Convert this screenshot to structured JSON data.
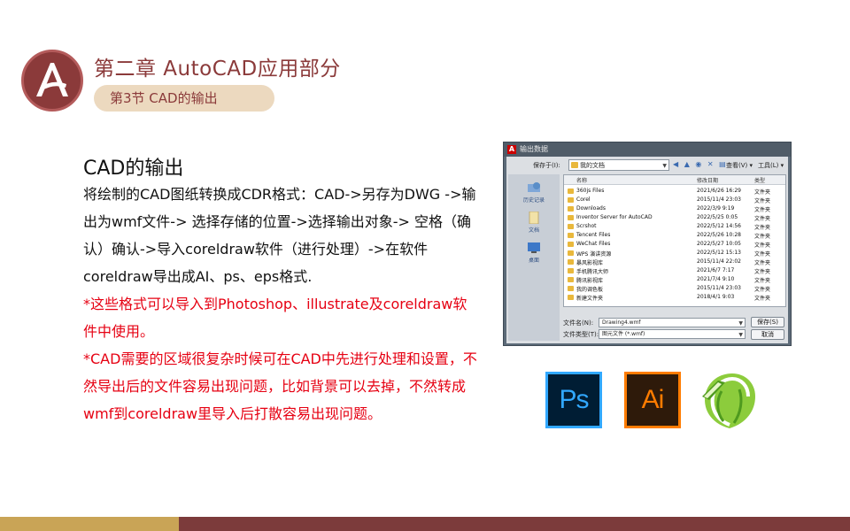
{
  "header": {
    "chapter_title": "第二章   AutoCAD应用部分",
    "section_label": "第3节  CAD的输出",
    "logo_letter": "A",
    "colors": {
      "brand": "#8b3a3a",
      "pill": "#ecd9bf"
    }
  },
  "content": {
    "heading": "CAD的输出",
    "paragraphs": [
      {
        "text": "将绘制的CAD图纸转换成CDR格式：CAD->另存为DWG ->输出为wmf文件-> 选择存储的位置->选择输出对象-> 空格（确认）确认->导入coreldraw软件（进行处理）->在软件coreldraw导出成AI、ps、eps格式.",
        "color": "#111111"
      },
      {
        "text": "*这些格式可以导入到Photoshop、illustrate及coreldraw软件中使用。",
        "color": "#e60012"
      },
      {
        "text": "*CAD需要的区域很复杂时候可在CAD中先进行处理和设置，不然导出后的文件容易出现问题，比如背景可以去掉，不然转成wmf到coreldraw里导入后打散容易出现问题。",
        "color": "#e60012"
      }
    ]
  },
  "dialog": {
    "title": "输出数据",
    "save_in_label": "保存于(I):",
    "save_in_value": "我的文档",
    "toolbar_icons": "◀ ▲ ◉ ✕ ▤",
    "view_label": "查看(V) ▾",
    "tools_label": "工具(L) ▾",
    "places": [
      "历史记录",
      "文档",
      "桌面"
    ],
    "columns": [
      "名称",
      "修改日期",
      "类型"
    ],
    "files": [
      {
        "name": "360js Files",
        "date": "2021/6/26 16:29",
        "type": "文件夹"
      },
      {
        "name": "Corel",
        "date": "2015/11/4 23:03",
        "type": "文件夹"
      },
      {
        "name": "Downloads",
        "date": "2022/3/9 9:19",
        "type": "文件夹"
      },
      {
        "name": "Inventor Server for AutoCAD",
        "date": "2022/5/25 0:05",
        "type": "文件夹"
      },
      {
        "name": "Scrshot",
        "date": "2022/5/12 14:56",
        "type": "文件夹"
      },
      {
        "name": "Tencent Files",
        "date": "2022/5/26 10:28",
        "type": "文件夹"
      },
      {
        "name": "WeChat Files",
        "date": "2022/5/27 10:05",
        "type": "文件夹"
      },
      {
        "name": "WPS 演讲资源",
        "date": "2022/5/12 15:13",
        "type": "文件夹"
      },
      {
        "name": "暴风影视库",
        "date": "2015/11/4 22:02",
        "type": "文件夹"
      },
      {
        "name": "手机腾讯大师",
        "date": "2021/6/7 7:17",
        "type": "文件夹"
      },
      {
        "name": "腾讯影视库",
        "date": "2021/7/4 9:10",
        "type": "文件夹"
      },
      {
        "name": "我的调色板",
        "date": "2015/11/4 23:03",
        "type": "文件夹"
      },
      {
        "name": "新建文件夹",
        "date": "2018/4/1 9:03",
        "type": "文件夹"
      }
    ],
    "filename_label": "文件名(N):",
    "filename_value": "Drawing4.wmf",
    "filetype_label": "文件类型(T):",
    "filetype_value": "图元文件 (*.wmf)",
    "save_button": "保存(S)",
    "cancel_button": "取消"
  },
  "apps": {
    "ps_label": "Ps",
    "ai_label": "Ai",
    "colors": {
      "ps": "#31a8ff",
      "ai": "#ff7c00",
      "coreldraw": "#6bbf2f"
    }
  },
  "footer": {
    "colors": {
      "left": "#c9a456",
      "right": "#7c3b3b"
    }
  }
}
